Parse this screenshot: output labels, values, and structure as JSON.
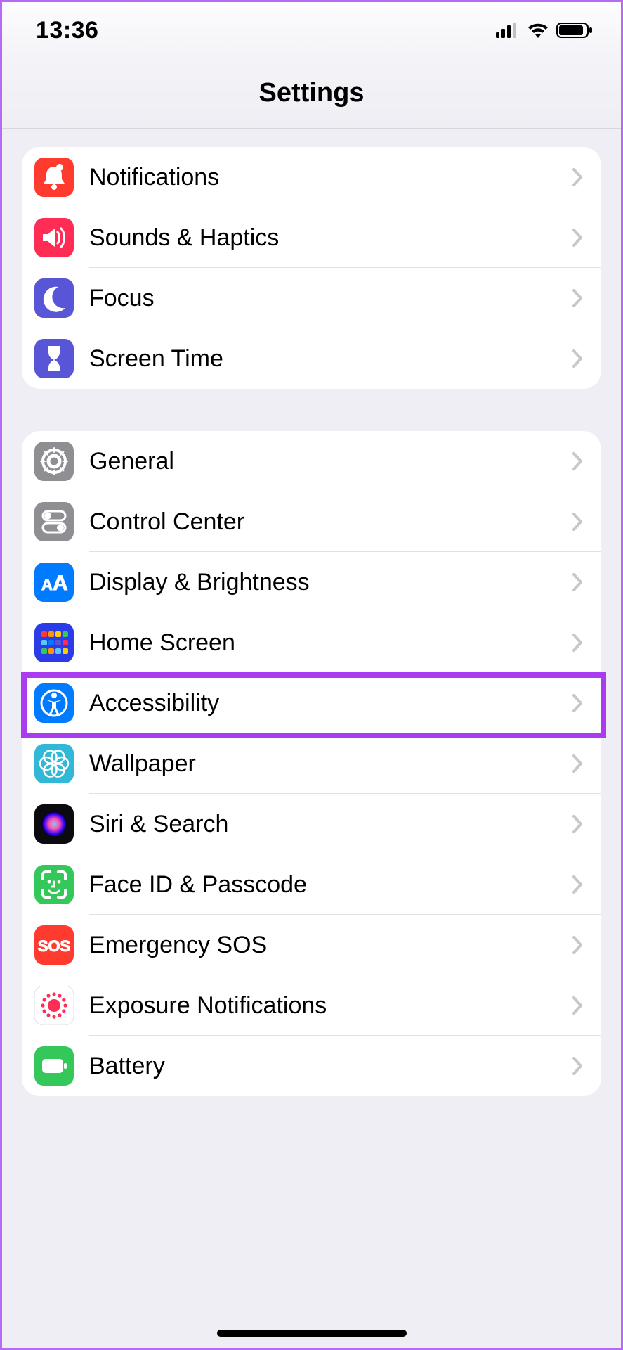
{
  "status": {
    "time": "13:36"
  },
  "header": {
    "title": "Settings"
  },
  "groups": [
    {
      "items": [
        {
          "icon": "notifications-icon",
          "label": "Notifications",
          "color": "#ff3b30"
        },
        {
          "icon": "sounds-icon",
          "label": "Sounds & Haptics",
          "color": "#ff2d55"
        },
        {
          "icon": "focus-icon",
          "label": "Focus",
          "color": "#5856d6"
        },
        {
          "icon": "screentime-icon",
          "label": "Screen Time",
          "color": "#5856d6"
        }
      ]
    },
    {
      "items": [
        {
          "icon": "general-icon",
          "label": "General",
          "color": "#8e8e93"
        },
        {
          "icon": "control-center-icon",
          "label": "Control Center",
          "color": "#8e8e93"
        },
        {
          "icon": "display-icon",
          "label": "Display & Brightness",
          "color": "#007aff"
        },
        {
          "icon": "home-screen-icon",
          "label": "Home Screen",
          "color": "#2a3be8"
        },
        {
          "icon": "accessibility-icon",
          "label": "Accessibility",
          "color": "#007aff",
          "highlight": true
        },
        {
          "icon": "wallpaper-icon",
          "label": "Wallpaper",
          "color": "#31b8d6"
        },
        {
          "icon": "siri-icon",
          "label": "Siri & Search",
          "color": "#131313"
        },
        {
          "icon": "faceid-icon",
          "label": "Face ID & Passcode",
          "color": "#34c759"
        },
        {
          "icon": "sos-icon",
          "label": "Emergency SOS",
          "color": "#ff3b30"
        },
        {
          "icon": "exposure-icon",
          "label": "Exposure Notifications",
          "color": "#ffffff"
        },
        {
          "icon": "battery-icon",
          "label": "Battery",
          "color": "#34c759"
        }
      ]
    }
  ]
}
